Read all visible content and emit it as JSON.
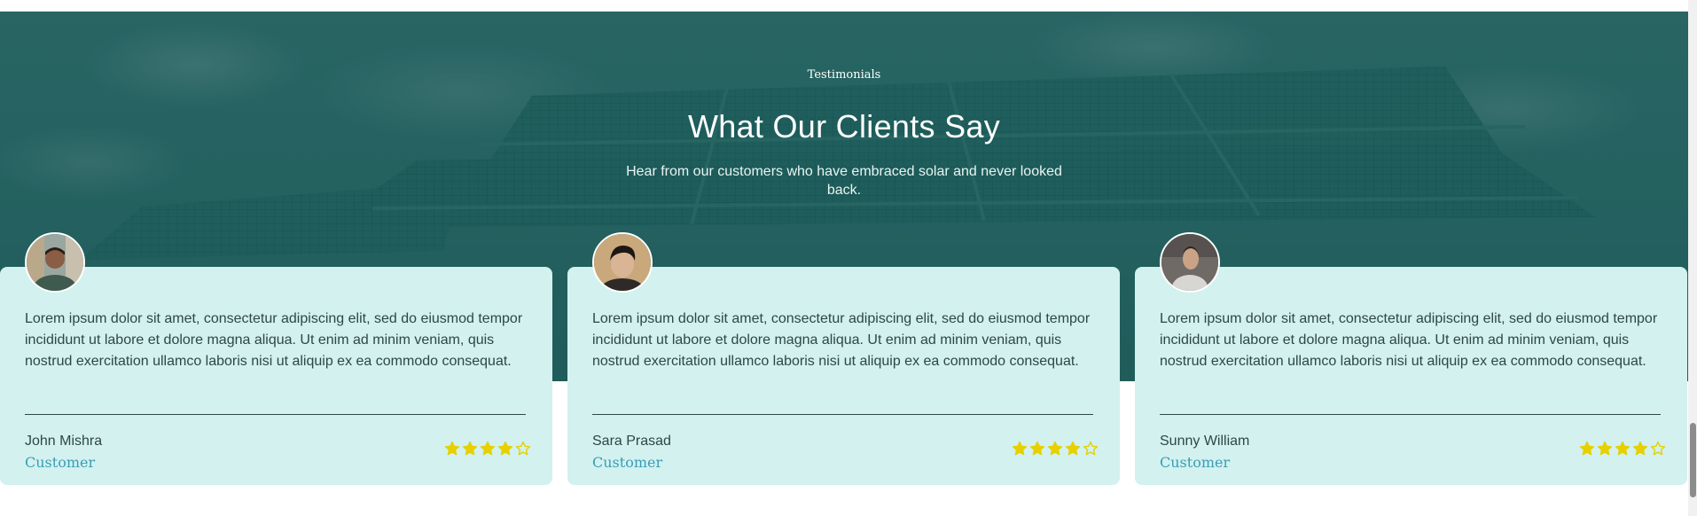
{
  "section": {
    "eyebrow": "Testimonials",
    "title": "What Our Clients Say",
    "subtitle": "Hear from our customers who have embraced solar and never looked back."
  },
  "testimonials": [
    {
      "quote": "Lorem ipsum dolor sit amet, consectetur adipiscing elit, sed do eiusmod tempor incididunt ut labore et dolore magna aliqua. Ut enim ad minim veniam, quis nostrud exercitation ullamco laboris nisi ut aliquip ex ea commodo consequat.",
      "name": "John Mishra",
      "role": "Customer",
      "rating": 4,
      "max_rating": 5
    },
    {
      "quote": "Lorem ipsum dolor sit amet, consectetur adipiscing elit, sed do eiusmod tempor incididunt ut labore et dolore magna aliqua. Ut enim ad minim veniam, quis nostrud exercitation ullamco laboris nisi ut aliquip ex ea commodo consequat.",
      "name": "Sara Prasad",
      "role": "Customer",
      "rating": 4,
      "max_rating": 5
    },
    {
      "quote": "Lorem ipsum dolor sit amet, consectetur adipiscing elit, sed do eiusmod tempor incididunt ut labore et dolore magna aliqua. Ut enim ad minim veniam, quis nostrud exercitation ullamco laboris nisi ut aliquip ex ea commodo consequat.",
      "name": "Sunny William",
      "role": "Customer",
      "rating": 4,
      "max_rating": 5
    }
  ],
  "colors": {
    "card_bg": "#d2f1ef",
    "accent": "#3a9db7",
    "star": "#e6d000",
    "hero_overlay": "#2a6866"
  }
}
